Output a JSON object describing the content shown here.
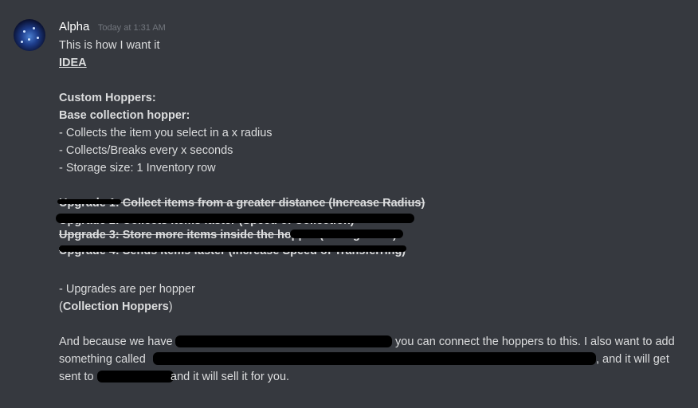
{
  "message": {
    "author": "Alpha",
    "timestamp": "Today at 1:31 AM",
    "lines": [
      "This is how I want it",
      "IDEA",
      "Custom Hoppers:",
      "Base collection hopper:",
      "- Collects the item you select in a x radius",
      "- Collects/Breaks every x seconds",
      "- Storage size: 1 Inventory row",
      "Upgrade 1: Collect items from a greater distance (Increase Radius)",
      "Upgrade 2: Collects items faster (Speed of Collection)",
      "Upgrade 3: Store more items inside the hopper (Storage Size)",
      "Upgrade 4: Sends items faster (Increase Speed of Transferring)",
      "- Upgrades are per hopper",
      "(",
      "Collection Hoppers",
      ")"
    ],
    "paragraph": {
      "part1": "And because we have",
      "part2": "you can connect the hoppers to this. I also want to add",
      "part3": "something called",
      "part4": ", and it will get",
      "part5": "sent to",
      "part6": "and it will sell it for you."
    }
  }
}
